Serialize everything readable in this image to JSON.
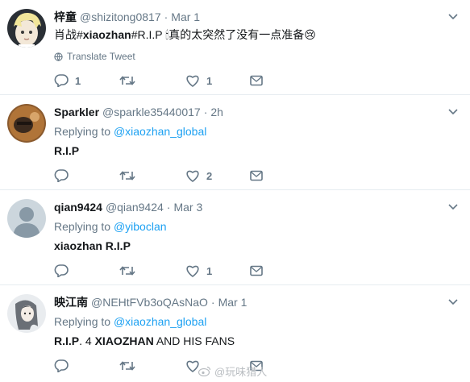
{
  "tweets": [
    {
      "name": "梓童",
      "handle": "@shizitong0817",
      "dot": "·",
      "time": "Mar 1",
      "text_pre": "肖战#",
      "text_bold": "xiaozhan",
      "text_post": "#R.I.P 🕯真的太突然了没有一点准备😢",
      "translate": "Translate Tweet",
      "replies": "1",
      "retweets": "",
      "likes": "1"
    },
    {
      "name": "Sparkler",
      "handle": "@sparkle35440017",
      "dot": "·",
      "time": "2h",
      "replying_prefix": "Replying to",
      "replying_to": "@xiaozhan_global",
      "text": "R.I.P",
      "replies": "",
      "retweets": "",
      "likes": "2"
    },
    {
      "name": "qian9424",
      "handle": "@qian9424",
      "dot": "·",
      "time": "Mar 3",
      "replying_prefix": "Replying to",
      "replying_to": "@yiboclan",
      "text": "xiaozhan R.I.P",
      "replies": "",
      "retweets": "",
      "likes": "1"
    },
    {
      "name": "映江南",
      "handle": "@NEHtFVb3oQAsNaO",
      "dot": "·",
      "time": "Mar 1",
      "replying_prefix": "Replying to",
      "replying_to": "@xiaozhan_global",
      "text_b1": "R.I.P",
      "text_m1": ". 4 ",
      "text_b2": "XIAOZHAN",
      "text_m2": " AND HIS FANS",
      "replies": "",
      "retweets": "",
      "likes": ""
    }
  ],
  "watermark": "@玩味猎人",
  "colors": {
    "link": "#1da1f2",
    "muted": "#657786",
    "text": "#14171a",
    "border": "#e6ecf0"
  },
  "icons": {
    "reply": "reply-icon",
    "retweet": "retweet-icon",
    "like": "heart-icon",
    "dm": "envelope-icon",
    "more": "chevron-down-icon",
    "translate": "globe-icon"
  }
}
